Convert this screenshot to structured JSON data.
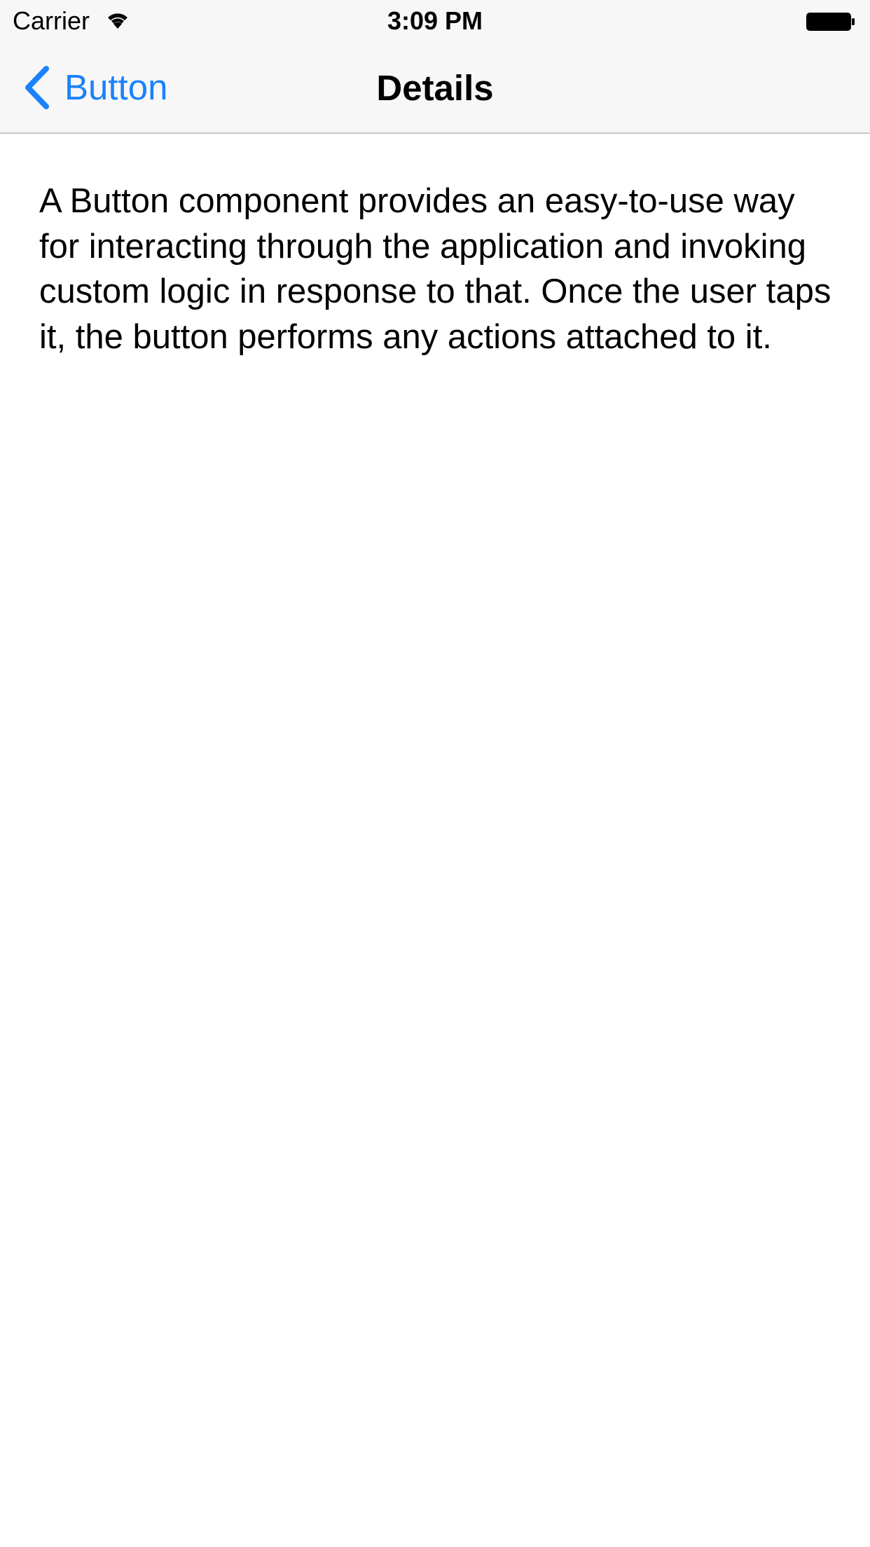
{
  "status_bar": {
    "carrier": "Carrier",
    "time": "3:09 PM",
    "wifi_icon": "wifi-icon",
    "battery_icon": "battery-icon"
  },
  "nav_bar": {
    "back_label": "Button",
    "back_icon": "chevron-left-icon",
    "title": "Details",
    "accent_color": "#1a82fb"
  },
  "content": {
    "description": "A Button component provides an easy-to-use way for interacting through the application and invoking custom logic in response to that. Once the user taps it, the button performs any actions attached to it."
  }
}
